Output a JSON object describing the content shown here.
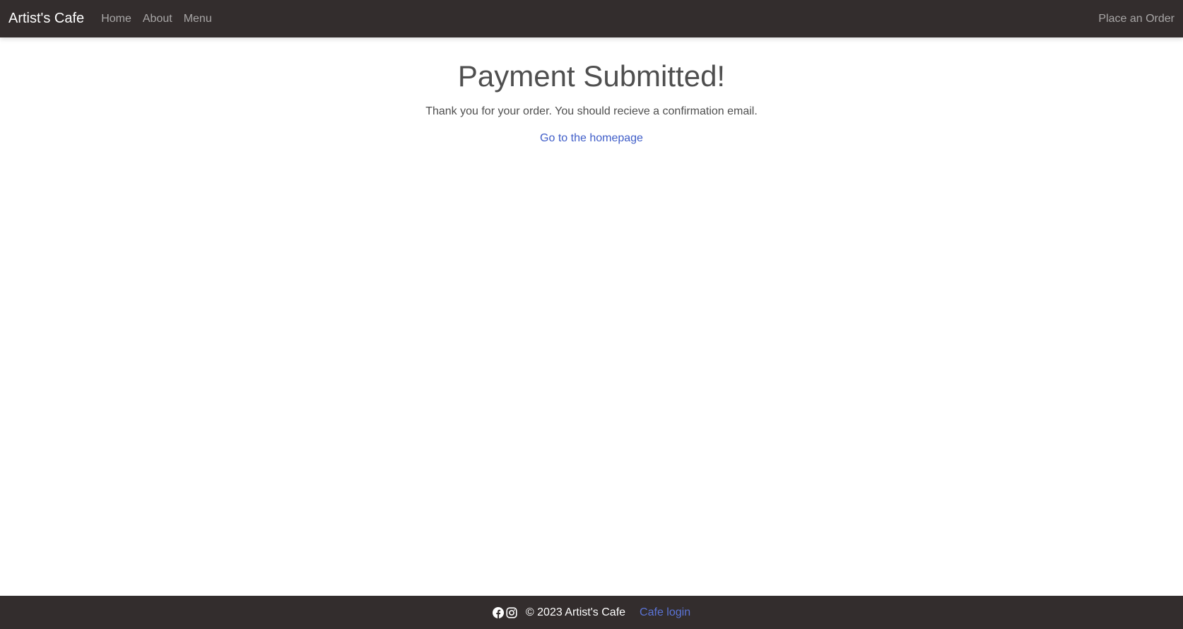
{
  "navbar": {
    "brand": "Artist's Cafe",
    "links": [
      {
        "label": "Home"
      },
      {
        "label": "About"
      },
      {
        "label": "Menu"
      }
    ],
    "right_link": "Place an Order"
  },
  "main": {
    "title": "Payment Submitted!",
    "message": "Thank you for your order. You should recieve a confirmation email.",
    "home_link": "Go to the homepage"
  },
  "footer": {
    "icons": [
      "facebook-icon",
      "instagram-icon"
    ],
    "copyright": "© 2023 Artist's Cafe",
    "login_link": "Cafe login"
  },
  "colors": {
    "nav_bg": "#332d2d",
    "nav_link": "#a8a6a6",
    "text": "#4f4f4f",
    "link": "#3f5dc8",
    "footer_link": "#5b74d6"
  }
}
